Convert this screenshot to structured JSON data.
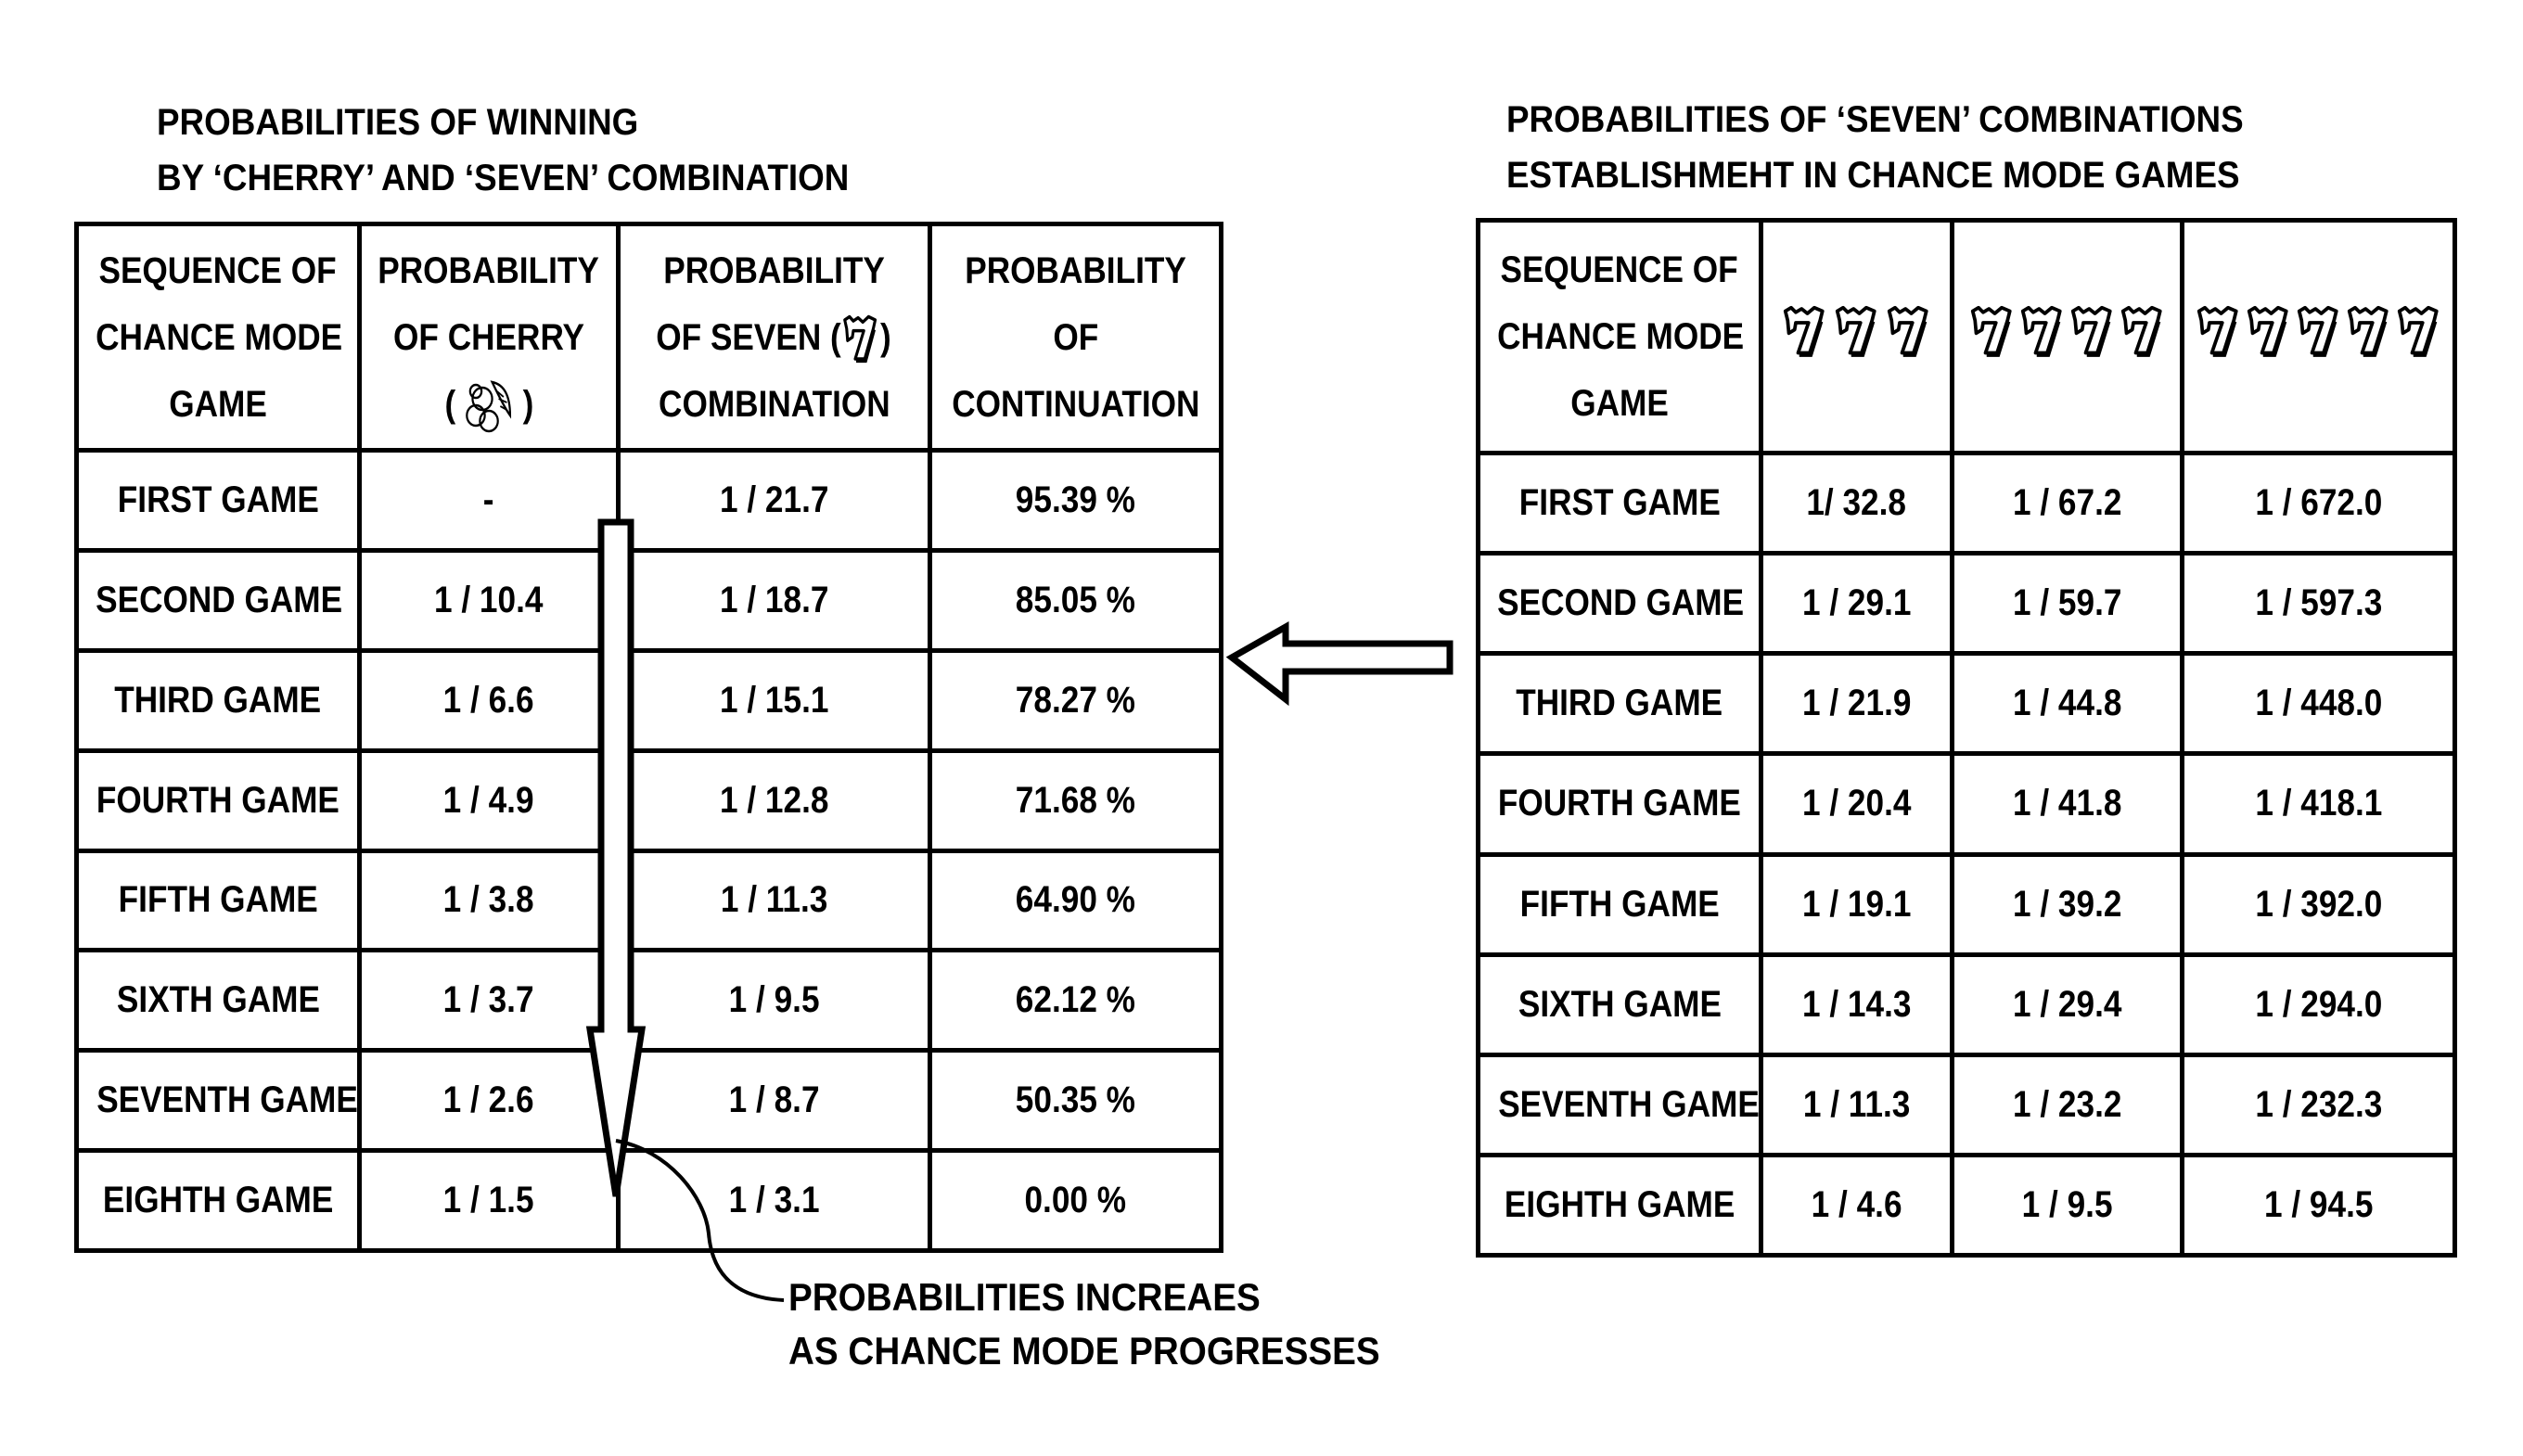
{
  "left_table": {
    "title_lines": [
      "PROBABILITIES OF WINNING",
      "BY ‘CHERRY’ AND ‘SEVEN’ COMBINATION"
    ],
    "headers": [
      {
        "lines": [
          "SEQUENCE OF",
          "CHANCE MODE",
          "GAME"
        ]
      },
      {
        "lines": [
          "PROBABILITY",
          "OF CHERRY",
          "(",
          ")"
        ],
        "icon": "cherry-icon"
      },
      {
        "lines": [
          "PROBABILITY",
          "OF SEVEN (",
          ")",
          "COMBINATION"
        ],
        "icon": "seven-icon"
      },
      {
        "lines": [
          "PROBABILITY",
          "OF",
          "CONTINUATION"
        ]
      }
    ],
    "rows": [
      {
        "game": "FIRST GAME",
        "cherry": "-",
        "seven": "1 / 21.7",
        "continuation": "95.39 %"
      },
      {
        "game": "SECOND GAME",
        "cherry": "1 / 10.4",
        "seven": "1 / 18.7",
        "continuation": "85.05 %"
      },
      {
        "game": "THIRD GAME",
        "cherry": "1 / 6.6",
        "seven": "1 / 15.1",
        "continuation": "78.27 %"
      },
      {
        "game": "FOURTH GAME",
        "cherry": "1 / 4.9",
        "seven": "1 / 12.8",
        "continuation": "71.68 %"
      },
      {
        "game": "FIFTH GAME",
        "cherry": "1 / 3.8",
        "seven": "1 / 11.3",
        "continuation": "64.90 %"
      },
      {
        "game": "SIXTH GAME",
        "cherry": "1 / 3.7",
        "seven": "1 / 9.5",
        "continuation": "62.12 %"
      },
      {
        "game": "SEVENTH GAME",
        "cherry": "1 / 2.6",
        "seven": "1 / 8.7",
        "continuation": "50.35 %"
      },
      {
        "game": "EIGHTH GAME",
        "cherry": "1 / 1.5",
        "seven": "1 / 3.1",
        "continuation": "0.00 %"
      }
    ]
  },
  "right_table": {
    "title_lines": [
      "PROBABILITIES OF ‘SEVEN’ COMBINATIONS",
      "ESTABLISHMEHT IN CHANCE MODE GAMES"
    ],
    "headers": [
      {
        "lines": [
          "SEQUENCE OF",
          "CHANCE MODE",
          "GAME"
        ]
      },
      {
        "icon": "seven-icon",
        "count": 3
      },
      {
        "icon": "seven-icon",
        "count": 4
      },
      {
        "icon": "seven-icon",
        "count": 5
      }
    ],
    "rows": [
      {
        "game": "FIRST GAME",
        "three": "1/ 32.8",
        "four": "1 / 67.2",
        "five": "1 / 672.0"
      },
      {
        "game": "SECOND GAME",
        "three": "1 / 29.1",
        "four": "1 / 59.7",
        "five": "1 / 597.3"
      },
      {
        "game": "THIRD GAME",
        "three": "1 / 21.9",
        "four": "1 / 44.8",
        "five": "1 / 448.0"
      },
      {
        "game": "FOURTH GAME",
        "three": "1 / 20.4",
        "four": "1 / 41.8",
        "five": "1 / 418.1"
      },
      {
        "game": "FIFTH GAME",
        "three": "1 / 19.1",
        "four": "1 / 39.2",
        "five": "1 / 392.0"
      },
      {
        "game": "SIXTH GAME",
        "three": "1 / 14.3",
        "four": "1 / 29.4",
        "five": "1 / 294.0"
      },
      {
        "game": "SEVENTH GAME",
        "three": "1 / 11.3",
        "four": "1 / 23.2",
        "five": "1 / 232.3"
      },
      {
        "game": "EIGHTH GAME",
        "three": "1 / 4.6",
        "four": "1 / 9.5",
        "five": "1 / 94.5"
      }
    ]
  },
  "annotation": {
    "lines": [
      "PROBABILITIES INCREAES",
      "AS CHANCE MODE PROGRESSES"
    ]
  },
  "arrows": {
    "left_arrow": "points from right table to left table",
    "down_arrow": "progression downward through chance mode games"
  }
}
